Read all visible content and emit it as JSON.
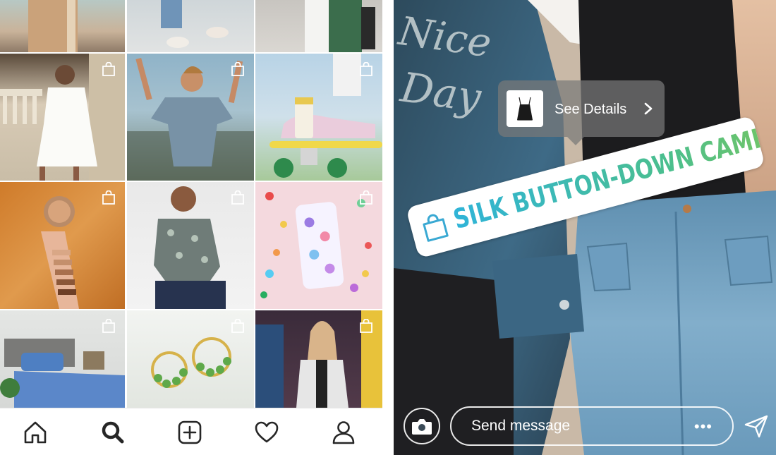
{
  "explore": {
    "tiles": [
      {
        "name": "tile-trench-coat",
        "shop": false
      },
      {
        "name": "tile-sneakers-walk",
        "shop": false
      },
      {
        "name": "tile-green-jacket",
        "shop": false
      },
      {
        "name": "tile-white-dress",
        "shop": true
      },
      {
        "name": "tile-blue-blouse",
        "shop": true
      },
      {
        "name": "tile-skateboard-sneaker",
        "shop": true
      },
      {
        "name": "tile-makeup-swatch",
        "shop": true
      },
      {
        "name": "tile-floral-shirt",
        "shop": true
      },
      {
        "name": "tile-phone-case",
        "shop": true
      },
      {
        "name": "tile-blue-bedding",
        "shop": true
      },
      {
        "name": "tile-green-earrings",
        "shop": true
      },
      {
        "name": "tile-arcade-jacket",
        "shop": true
      }
    ],
    "nav": [
      {
        "icon": "home-icon"
      },
      {
        "icon": "search-icon",
        "active": true
      },
      {
        "icon": "new-post-icon"
      },
      {
        "icon": "heart-icon"
      },
      {
        "icon": "profile-icon"
      }
    ]
  },
  "story": {
    "tooltip_label": "See Details",
    "product_tag": "SILK BUTTON-DOWN CAMI",
    "message_placeholder": "Send message",
    "more_label": "•••",
    "colors": {
      "tag_gradient_start": "#2fb4d8",
      "tag_gradient_end": "#6dc46a",
      "tooltip_bg": "#787878"
    }
  }
}
